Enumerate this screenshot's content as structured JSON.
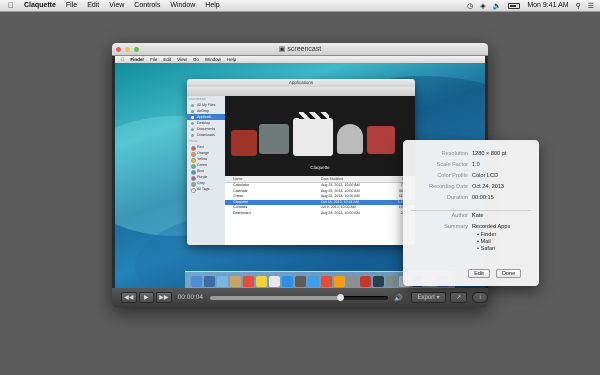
{
  "menubar": {
    "app_name": "Claquette",
    "items": [
      "File",
      "Edit",
      "View",
      "Controls",
      "Window",
      "Help"
    ],
    "clock": "Mon 9:41 AM"
  },
  "player": {
    "title": "screencast",
    "current_time": "00:00:04",
    "progress": 0.73,
    "export_label": "Export ▾"
  },
  "screen": {
    "finder_menu": [
      "Finder",
      "File",
      "Edit",
      "View",
      "Go",
      "Window",
      "Help"
    ],
    "finder": {
      "title": "Applications",
      "sidebar_header": "FAVORITES",
      "sidebar": [
        "All My Files",
        "AirDrop",
        "Applicati...",
        "Desktop",
        "Documents",
        "Downloads"
      ],
      "tags_header": "TAGS",
      "tags": [
        {
          "name": "Red",
          "color": "#e64b3c"
        },
        {
          "name": "Orange",
          "color": "#f39c12"
        },
        {
          "name": "Yellow",
          "color": "#f1c40f"
        },
        {
          "name": "Green",
          "color": "#2ecc71"
        },
        {
          "name": "Blue",
          "color": "#3498db"
        },
        {
          "name": "Purple",
          "color": "#9b59b6"
        },
        {
          "name": "Gray",
          "color": "#95a5a6"
        },
        {
          "name": "All Tags...",
          "color": "#ffffff"
        }
      ],
      "preview_label": "Claquette",
      "columns": [
        "Name",
        "Date Modified",
        "Size"
      ],
      "rows": [
        {
          "name": "Calculator",
          "date": "Aug 25, 2013, 10:00 AM",
          "size": "7 MB",
          "selected": false
        },
        {
          "name": "Calendar",
          "date": "Aug 25, 2013, 10:00 AM",
          "size": "36 MB",
          "selected": false
        },
        {
          "name": "Chess",
          "date": "Aug 25, 2013, 10:00 AM",
          "size": "11 MB",
          "selected": false
        },
        {
          "name": "Claquette",
          "date": "Oct 16, 2013, 10:41 AM",
          "size": "5.8 MB",
          "selected": true
        },
        {
          "name": "Contacts",
          "date": "Jul 9, 2013, 10:00 AM",
          "size": "15 MB",
          "selected": false
        },
        {
          "name": "Dashboard",
          "date": "Aug 25, 2013, 10:00 AM",
          "size": "2 MB",
          "selected": false
        }
      ]
    }
  },
  "info": {
    "fields": [
      {
        "key": "Resolution",
        "value": "1280 × 800 pt"
      },
      {
        "key": "Scale Factor",
        "value": "1.0"
      },
      {
        "key": "Color Profile",
        "value": "Color LCD"
      },
      {
        "key": "Recording Date",
        "value": "Oct 24, 2013"
      },
      {
        "key": "Duration",
        "value": "00:00:15"
      }
    ],
    "author_key": "Author",
    "author_value": "Kate",
    "summary_key": "Summary",
    "summary_title": "Recorded Apps",
    "summary_items": [
      "• Finder",
      "• Mail",
      "• Safari"
    ],
    "edit_label": "Edit",
    "done_label": "Done"
  },
  "dock_colors": [
    "#4a90d9",
    "#3a6ea5",
    "#7ab3e0",
    "#c9a36b",
    "#e84c3d",
    "#f4d03f",
    "#e8e8e8",
    "#2d8fe0",
    "#5d5d5d",
    "#3e9fe8",
    "#e44c3c",
    "#f39c12",
    "#8e8e8e",
    "#c0392b",
    "#2c3e50",
    "#7f8c8d",
    "#bdc3c7",
    "#34495e",
    "#95a5a6",
    "#3a5f8a"
  ]
}
